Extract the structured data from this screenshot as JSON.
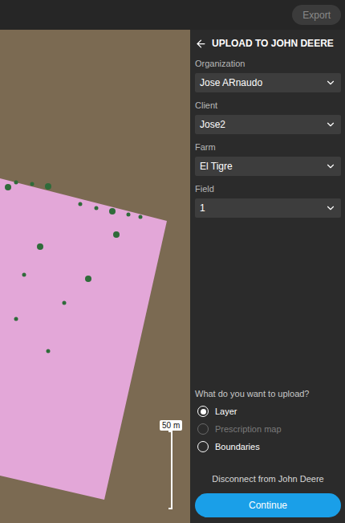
{
  "topbar": {
    "export": {
      "label": "Export",
      "disabled": true
    }
  },
  "map": {
    "scale": "50 m"
  },
  "panel": {
    "title": "UPLOAD TO JOHN DEERE",
    "fields": [
      {
        "label": "Organization",
        "value": "Jose ARnaudo"
      },
      {
        "label": "Client",
        "value": "Jose2"
      },
      {
        "label": "Farm",
        "value": "El Tigre"
      },
      {
        "label": "Field",
        "value": "1"
      }
    ],
    "upload": {
      "question": "What do you want to upload?",
      "options": [
        {
          "label": "Layer",
          "selected": true,
          "disabled": false
        },
        {
          "label": "Prescription map",
          "selected": false,
          "disabled": true
        },
        {
          "label": "Boundaries",
          "selected": false,
          "disabled": false
        }
      ]
    },
    "disconnect": "Disconnect from John Deere",
    "continue": "Continue"
  }
}
